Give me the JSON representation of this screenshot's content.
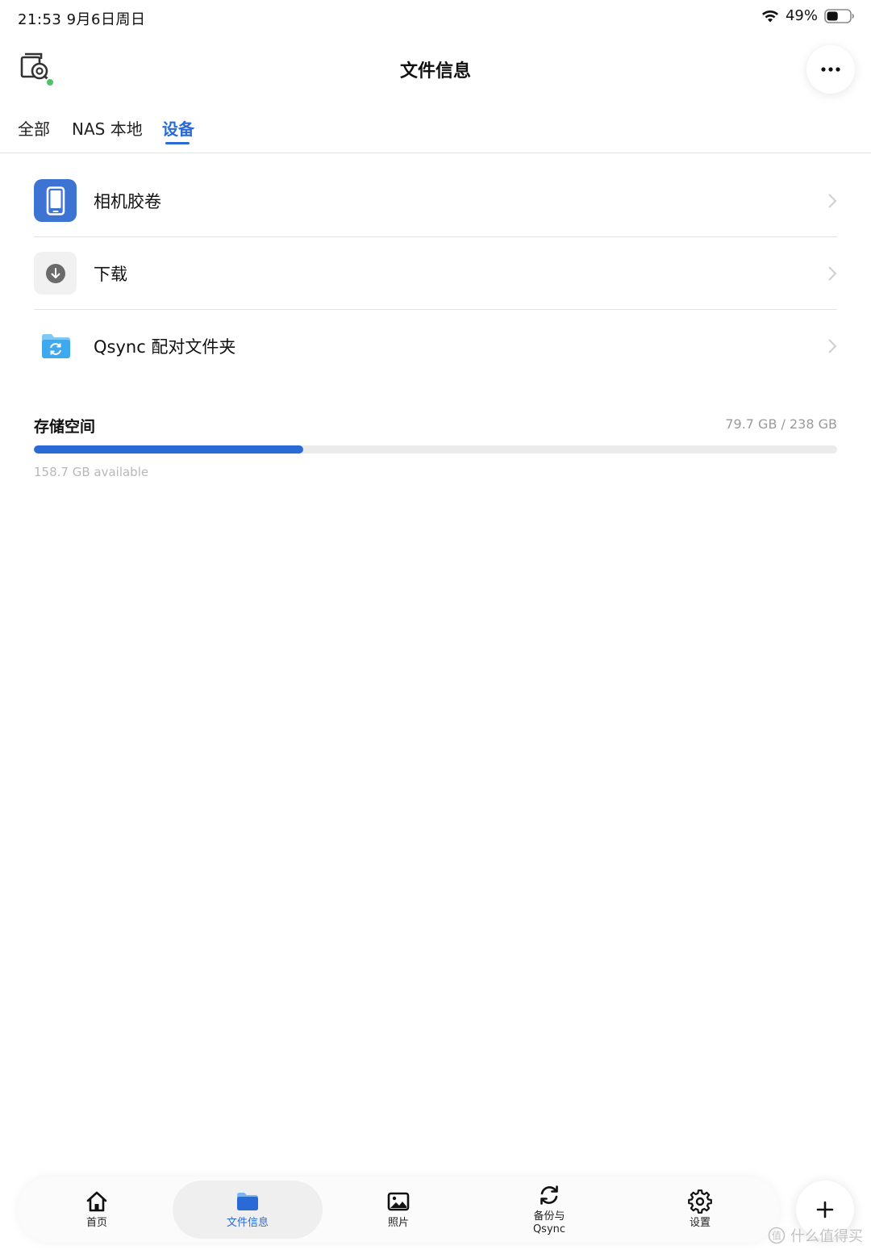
{
  "status_bar": {
    "time_date": "21:53  9月6日周日",
    "battery_percent": "49%",
    "battery_level": 0.49
  },
  "header": {
    "title": "文件信息"
  },
  "tabs": [
    {
      "label": "全部",
      "active": false
    },
    {
      "label": "NAS 本地",
      "active": false
    },
    {
      "label": "设备",
      "active": true
    }
  ],
  "list": [
    {
      "label": "相机胶卷",
      "icon": "phone-icon"
    },
    {
      "label": "下载",
      "icon": "download-icon"
    },
    {
      "label": "Qsync 配对文件夹",
      "icon": "sync-folder-icon"
    }
  ],
  "storage": {
    "title": "存储空间",
    "usage": "79.7 GB / 238 GB",
    "used_fraction": 0.335,
    "available": "158.7 GB available"
  },
  "bottom_nav": [
    {
      "label": "首页",
      "icon": "home-icon",
      "active": false
    },
    {
      "label": "文件信息",
      "icon": "folder-icon",
      "active": true
    },
    {
      "label": "照片",
      "icon": "photo-icon",
      "active": false
    },
    {
      "label": "备份与\nQsync",
      "icon": "sync-icon",
      "active": false
    },
    {
      "label": "设置",
      "icon": "gear-icon",
      "active": false
    }
  ],
  "watermark": {
    "text": "什么值得买"
  },
  "colors": {
    "accent": "#2a6ad6",
    "online": "#4cc36b",
    "phone_tile": "#3d74d4",
    "folder": "#3fa9f0"
  }
}
